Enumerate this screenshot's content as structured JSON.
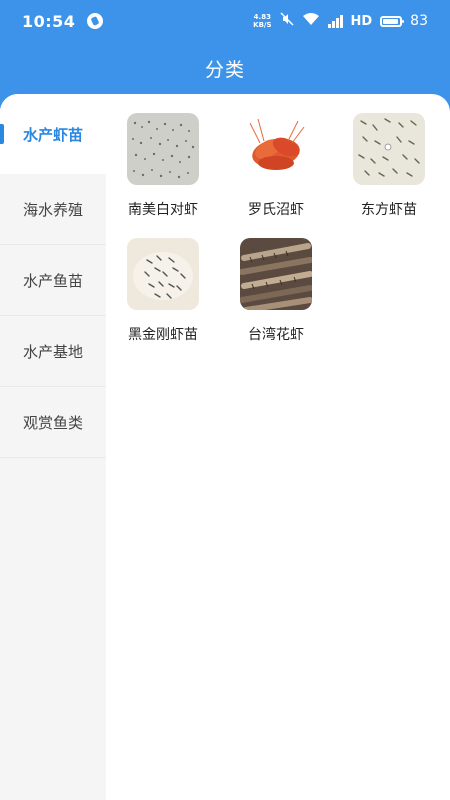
{
  "status": {
    "time": "10:54",
    "net_top": "4.83",
    "net_bottom": "KB/S",
    "hd": "HD",
    "battery": "83"
  },
  "header": {
    "title": "分类"
  },
  "sidebar": {
    "items": [
      {
        "label": "水产虾苗",
        "active": true
      },
      {
        "label": "海水养殖"
      },
      {
        "label": "水产鱼苗"
      },
      {
        "label": "水产基地"
      },
      {
        "label": "观赏鱼类"
      }
    ]
  },
  "products": [
    {
      "name": "南美白对虾",
      "image": "shrimp-fry-photo"
    },
    {
      "name": "罗氏沼虾",
      "image": "cooked-prawns-photo"
    },
    {
      "name": "东方虾苗",
      "image": "shrimp-fry-photo"
    },
    {
      "name": "黑金刚虾苗",
      "image": "shrimp-fry-photo"
    },
    {
      "name": "台湾花虾",
      "image": "mantis-shrimp-photo"
    }
  ],
  "colors": {
    "primary": "#3c93e9",
    "active_text": "#2b88e0",
    "sidebar_bg": "#f5f5f5"
  }
}
